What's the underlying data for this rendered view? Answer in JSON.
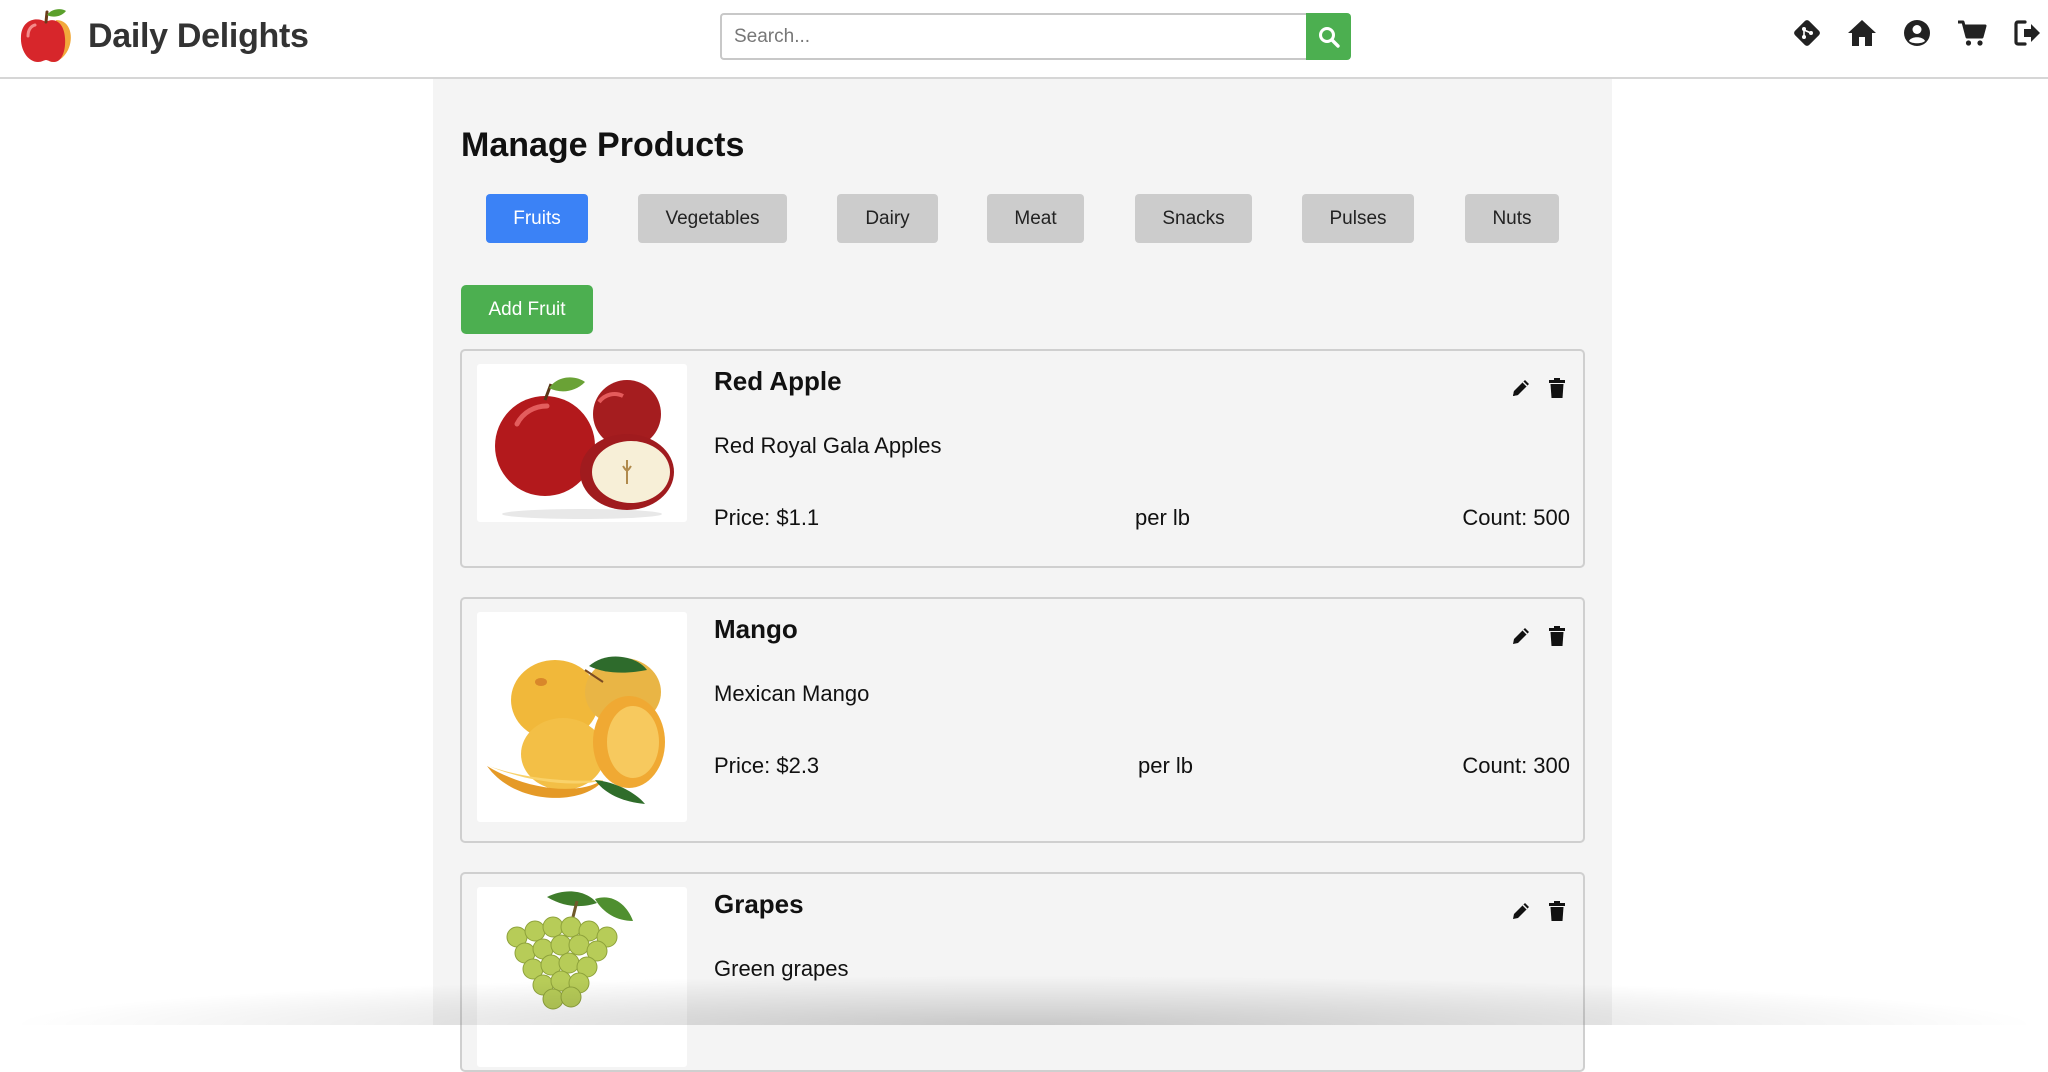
{
  "header": {
    "brand": "Daily Delights",
    "search": {
      "placeholder": "Search...",
      "value": ""
    },
    "icons": [
      "git-diamond-icon",
      "home-icon",
      "user-circle-icon",
      "cart-icon",
      "logout-icon"
    ]
  },
  "main": {
    "title": "Manage Products",
    "tabs": [
      {
        "label": "Fruits",
        "active": true
      },
      {
        "label": "Vegetables",
        "active": false
      },
      {
        "label": "Dairy",
        "active": false
      },
      {
        "label": "Meat",
        "active": false
      },
      {
        "label": "Snacks",
        "active": false
      },
      {
        "label": "Pulses",
        "active": false
      },
      {
        "label": "Nuts",
        "active": false
      }
    ],
    "add_button": "Add Fruit",
    "products": [
      {
        "name": "Red Apple",
        "description": "Red Royal Gala Apples",
        "price": "Price: $1.1",
        "unit": "per lb",
        "count": "Count: 500"
      },
      {
        "name": "Mango",
        "description": "Mexican Mango",
        "price": "Price: $2.3",
        "unit": "per lb",
        "count": "Count: 300"
      },
      {
        "name": "Grapes",
        "description": "Green grapes",
        "price": "",
        "unit": "",
        "count": ""
      }
    ]
  },
  "colors": {
    "accent_blue": "#3b82f6",
    "accent_green": "#4caf50",
    "tab_inactive": "#cccccc",
    "panel_bg": "#f4f4f4"
  }
}
